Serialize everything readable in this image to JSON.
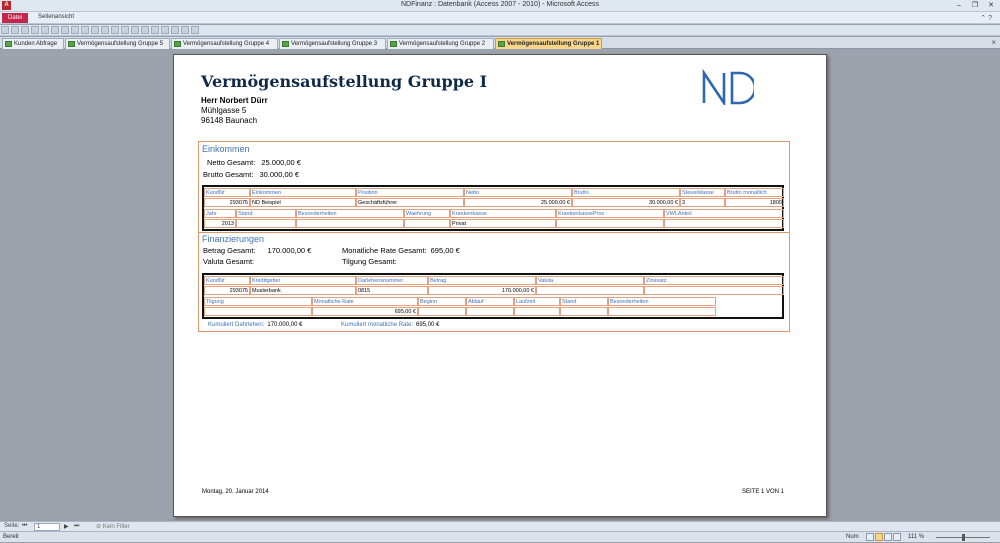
{
  "window": {
    "title": "NDFinanz : Datenbank (Access 2007 - 2010) - Microsoft Access",
    "app_icon": "A",
    "minimize": "–",
    "restore": "❐",
    "close": "✕"
  },
  "ribbon": {
    "file_tab": "Datei",
    "tab": "Seitenansicht"
  },
  "doc_tabs": [
    {
      "label": "Kunden Abfrage"
    },
    {
      "label": "Vermögensaufstellung Gruppe 5"
    },
    {
      "label": "Vermögensaufstellung Gruppe 4"
    },
    {
      "label": "Vermögensaufstellung Gruppe 3"
    },
    {
      "label": "Vermögensaufstellung Gruppe 2"
    },
    {
      "label": "Vermögensaufstellung Gruppe 1"
    }
  ],
  "report": {
    "title": "Vermögensaufstellung Gruppe I",
    "logo_text": "ND",
    "address": {
      "name": "Herr  Norbert Dürr",
      "street": "Mühlgasse 5",
      "city": "96148 Baunach"
    },
    "einkommen": {
      "heading": "Einkommen",
      "netto_label": "Netto Gesamt:",
      "netto_value": "25.000,00 €",
      "brutto_label": "Brutto Gesamt:",
      "brutto_value": "30.000,00 €",
      "row1_headers": [
        "KundNr",
        "Einkommen",
        "Position",
        "Netto",
        "Brutto",
        "Steuerklasse",
        "Brutto monatlich"
      ],
      "row1_values": [
        "293075",
        "ND Beispiel",
        "Geschäftsführer",
        "25.000,00 €",
        "30.000,00 €",
        "3",
        "1800"
      ],
      "row2_headers": [
        "Jahr",
        "Stand",
        "Besonderheiten",
        "Waehrung",
        "Krankenkasse",
        "KrankenkasseProz",
        "VWLAnteil"
      ],
      "row2_values": [
        "2013",
        "",
        "",
        "",
        "Privat",
        "",
        ""
      ]
    },
    "finanzierungen": {
      "heading": "Finanzierungen",
      "betrag_label": "Betrag Gesamt:",
      "betrag_value": "170.000,00 €",
      "rate_label": "Monatliche Rate Gesamt:",
      "rate_value": "695,00 €",
      "valuta_label": "Valuta Gesamt:",
      "tilgung_label": "Tilgung Gesamt:",
      "row1_headers": [
        "KundNr",
        "Kreditgeber",
        "Darlehensnummer",
        "Betrag",
        "Valuta",
        "Zinssatz"
      ],
      "row1_values": [
        "293075",
        "Musterbank",
        "0815",
        "170.000,00 €",
        "",
        ""
      ],
      "row2_headers": [
        "Tilgung",
        "Monatliche Rate",
        "Beginn",
        "Ablauf",
        "Laufzeit",
        "Stand",
        "Besonderheiten"
      ],
      "row2_values": [
        "",
        "695,00 €",
        "",
        "",
        "",
        "",
        ""
      ],
      "kum_dar_label": "Kumuliert Dahrlehen:",
      "kum_dar_value": "170.000,00 €",
      "kum_rate_label": "Kumuliert monatliche Rate:",
      "kum_rate_value": "695,00 €"
    },
    "footer_date": "Montag, 20. Januar 2014",
    "footer_page": "SEITE 1 VON 1"
  },
  "navbar": {
    "page_label": "Seite:",
    "page_value": "1",
    "filter": "Kein Filter"
  },
  "status": {
    "left": "Bereit",
    "num": "Num",
    "zoom": "111 %"
  }
}
